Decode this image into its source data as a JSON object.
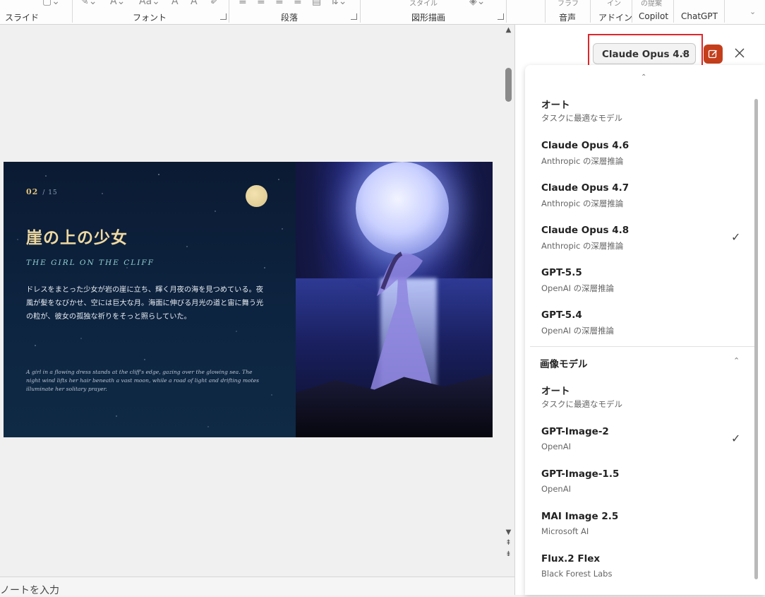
{
  "ribbon": {
    "groups": [
      "スライド",
      "フォント",
      "段落",
      "図形描画",
      "音声",
      "アドイン",
      "Copilot",
      "ChatGPT"
    ],
    "top_partials": [
      "スタイル",
      "の提案",
      "フラフ",
      "イン"
    ]
  },
  "notes": {
    "placeholder": "ノートを入力"
  },
  "slide": {
    "page_number": "02",
    "page_total": "/ 15",
    "title": "崖の上の少女",
    "subtitle": "THE GIRL ON THE CLIFF",
    "body_jp": "ドレスをまとった少女が岩の崖に立ち、輝く月夜の海を見つめている。夜風が髪をなびかせ、空には巨大な月。海面に伸びる月光の道と宙に舞う光の粒が、彼女の孤独な祈りをそっと照らしていた。",
    "body_en": "A girl in a flowing dress stands at the cliff's edge, gazing over the glowing sea. The night wind lifts her hair beneath a vast moon, while a road of light and drifting motes illuminate her solitary prayer."
  },
  "pane": {
    "model_selector": "Claude Opus 4.8",
    "text_models": [
      {
        "name": "オート",
        "desc": "タスクに最適なモデル",
        "selected": false
      },
      {
        "name": "Claude Opus 4.6",
        "desc": "Anthropic の深層推論",
        "selected": false
      },
      {
        "name": "Claude Opus 4.7",
        "desc": "Anthropic の深層推論",
        "selected": false
      },
      {
        "name": "Claude Opus 4.8",
        "desc": "Anthropic の深層推論",
        "selected": true
      },
      {
        "name": "GPT-5.5",
        "desc": "OpenAI の深層推論",
        "selected": false
      },
      {
        "name": "GPT-5.4",
        "desc": "OpenAI の深層推論",
        "selected": false
      }
    ],
    "image_section_title": "画像モデル",
    "image_models": [
      {
        "name": "オート",
        "desc": "タスクに最適なモデル",
        "selected": false
      },
      {
        "name": "GPT-Image-2",
        "desc": "OpenAI",
        "selected": true
      },
      {
        "name": "GPT-Image-1.5",
        "desc": "OpenAI",
        "selected": false
      },
      {
        "name": "MAI Image 2.5",
        "desc": "Microsoft AI",
        "selected": false
      },
      {
        "name": "Flux.2 Flex",
        "desc": "Black Forest Labs",
        "selected": false
      }
    ],
    "check_glyph": "✓"
  },
  "colors": {
    "accent": "#c43e1c",
    "highlight": "#e0262b",
    "title_gold": "#efd9a0",
    "subtitle_teal": "#8fd0cf"
  }
}
